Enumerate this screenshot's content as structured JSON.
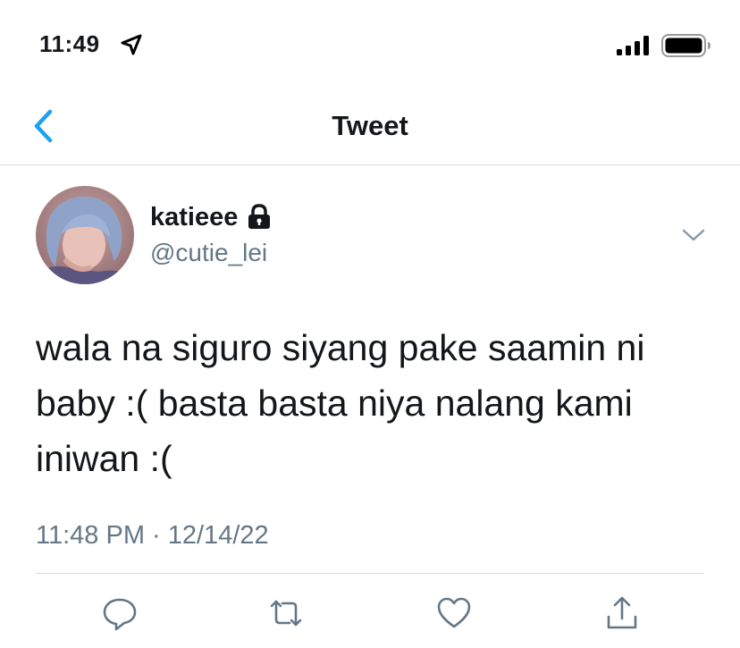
{
  "status_bar": {
    "time": "11:49",
    "location_icon": "location-arrow-icon",
    "signal_icon": "cellular-signal-icon",
    "battery_icon": "battery-icon"
  },
  "nav": {
    "back_icon": "chevron-left-icon",
    "title": "Tweet"
  },
  "tweet": {
    "author": {
      "display_name": "katieee",
      "handle": "@cutie_lei",
      "protected_icon": "lock-icon",
      "avatar_icon": "avatar"
    },
    "more_icon": "chevron-down-icon",
    "text": "wala na siguro siyang pake saamin ni\nbaby :( basta basta niya nalang kami\niniwan :(",
    "meta": "11:48 PM · 12/14/22"
  },
  "actions": [
    {
      "name": "reply",
      "icon": "reply-icon"
    },
    {
      "name": "retweet",
      "icon": "retweet-icon"
    },
    {
      "name": "like",
      "icon": "heart-icon"
    },
    {
      "name": "share",
      "icon": "share-icon"
    }
  ],
  "colors": {
    "accent": "#1da1f2",
    "text": "#14171a",
    "secondary": "#657786",
    "divider": "#d6d9dc"
  }
}
